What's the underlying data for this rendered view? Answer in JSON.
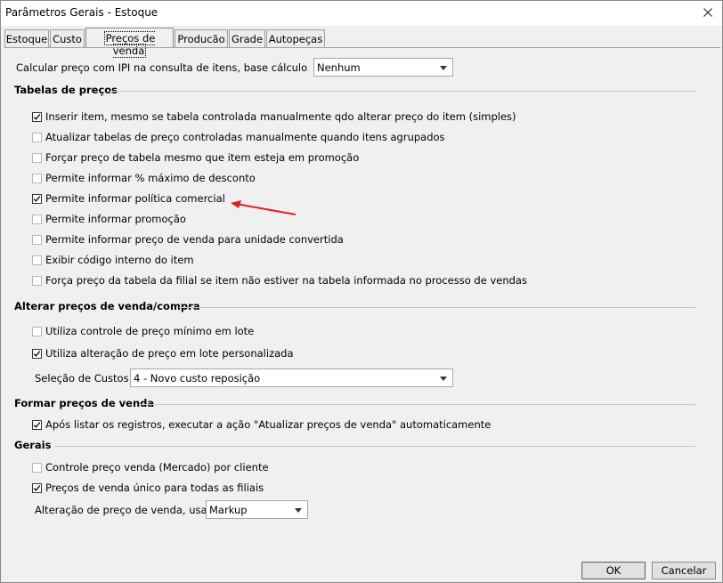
{
  "window": {
    "title": "Parâmetros Gerais - Estoque"
  },
  "tabs": [
    {
      "label": "Estoque"
    },
    {
      "label": "Custo"
    },
    {
      "label": "Preços de venda",
      "active": true
    },
    {
      "label": "Producão"
    },
    {
      "label": "Grade"
    },
    {
      "label": "Autopeças"
    }
  ],
  "ipi": {
    "label": "Calcular preço com IPI na consulta de itens, base cálculo",
    "value": "Nenhum"
  },
  "tabelas": {
    "title": "Tabelas de preços",
    "items": [
      {
        "label": "Inserir item, mesmo se tabela controlada manualmente qdo alterar preço do item (simples)",
        "checked": true
      },
      {
        "label": "Atualizar tabelas de preço controladas manualmente quando itens agrupados",
        "checked": false
      },
      {
        "label": "Forçar preço de tabela mesmo que item esteja em promoção",
        "checked": false
      },
      {
        "label": "Permite informar % máximo de desconto",
        "checked": false
      },
      {
        "label": "Permite informar política comercial",
        "checked": true
      },
      {
        "label": "Permite informar promoção",
        "checked": false
      },
      {
        "label": "Permite informar preço de venda para unidade convertida",
        "checked": false
      },
      {
        "label": "Exibir código interno do item",
        "checked": false
      },
      {
        "label": "Força preço da tabela da filial se item não estiver na tabela informada no processo de vendas",
        "checked": false
      }
    ]
  },
  "alterar": {
    "title": "Alterar preços de venda/compra",
    "items": [
      {
        "label": "Utiliza controle de preço mínimo em lote",
        "checked": false
      },
      {
        "label": "Utiliza alteração de preço em lote personalizada",
        "checked": true
      }
    ],
    "custos_label": "Seleção de Custos",
    "custos_value": "4 - Novo  custo reposição"
  },
  "formar": {
    "title": "Formar preços de venda",
    "items": [
      {
        "label": "Após listar os registros, executar a ação \"Atualizar preços de venda\" automaticamente",
        "checked": true
      }
    ]
  },
  "gerais": {
    "title": "Gerais",
    "items": [
      {
        "label": "Controle preço venda (Mercado) por cliente",
        "checked": false
      },
      {
        "label": "Preços de venda único para todas as filiais",
        "checked": true
      }
    ],
    "alteracao_label": "Alteração de preço de venda, usar",
    "alteracao_value": "Markup"
  },
  "buttons": {
    "ok": "OK",
    "cancel": "Cancelar"
  },
  "annotation": {
    "arrow_color": "#e02020"
  }
}
